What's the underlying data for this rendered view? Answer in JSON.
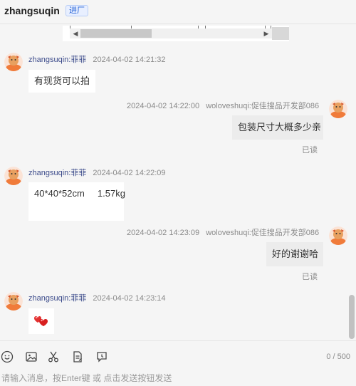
{
  "header": {
    "title": "zhangsuqin",
    "badge": "进厂"
  },
  "messages": [
    {
      "side": "left",
      "user": "zhangsuqin:菲菲",
      "time": "2024-04-02 14:21:32",
      "text": "有现货可以拍"
    },
    {
      "side": "right",
      "user": "woloveshuqi:促佳搜品开发部086",
      "time": "2024-04-02 14:22:00",
      "text": "包装尺寸大概多少亲",
      "status": "已读"
    },
    {
      "side": "left",
      "user": "zhangsuqin:菲菲",
      "time": "2024-04-02 14:22:09",
      "text": "40*40*52cm     1.57kg"
    },
    {
      "side": "right",
      "user": "woloveshuqi:促佳搜品开发部086",
      "time": "2024-04-02 14:23:09",
      "text": "好的谢谢哈",
      "status": "已读"
    },
    {
      "side": "left",
      "user": "zhangsuqin:菲菲",
      "time": "2024-04-02 14:23:14",
      "text": "",
      "content_icon": "red-hearts-sticker-icon"
    }
  ],
  "composer": {
    "counter": "0 / 500",
    "placeholder": "请输入消息，按Enter键 或 点击发送按钮发送",
    "tools": [
      "emoji-icon",
      "image-icon",
      "scissors-icon",
      "document-icon",
      "history-icon"
    ]
  }
}
